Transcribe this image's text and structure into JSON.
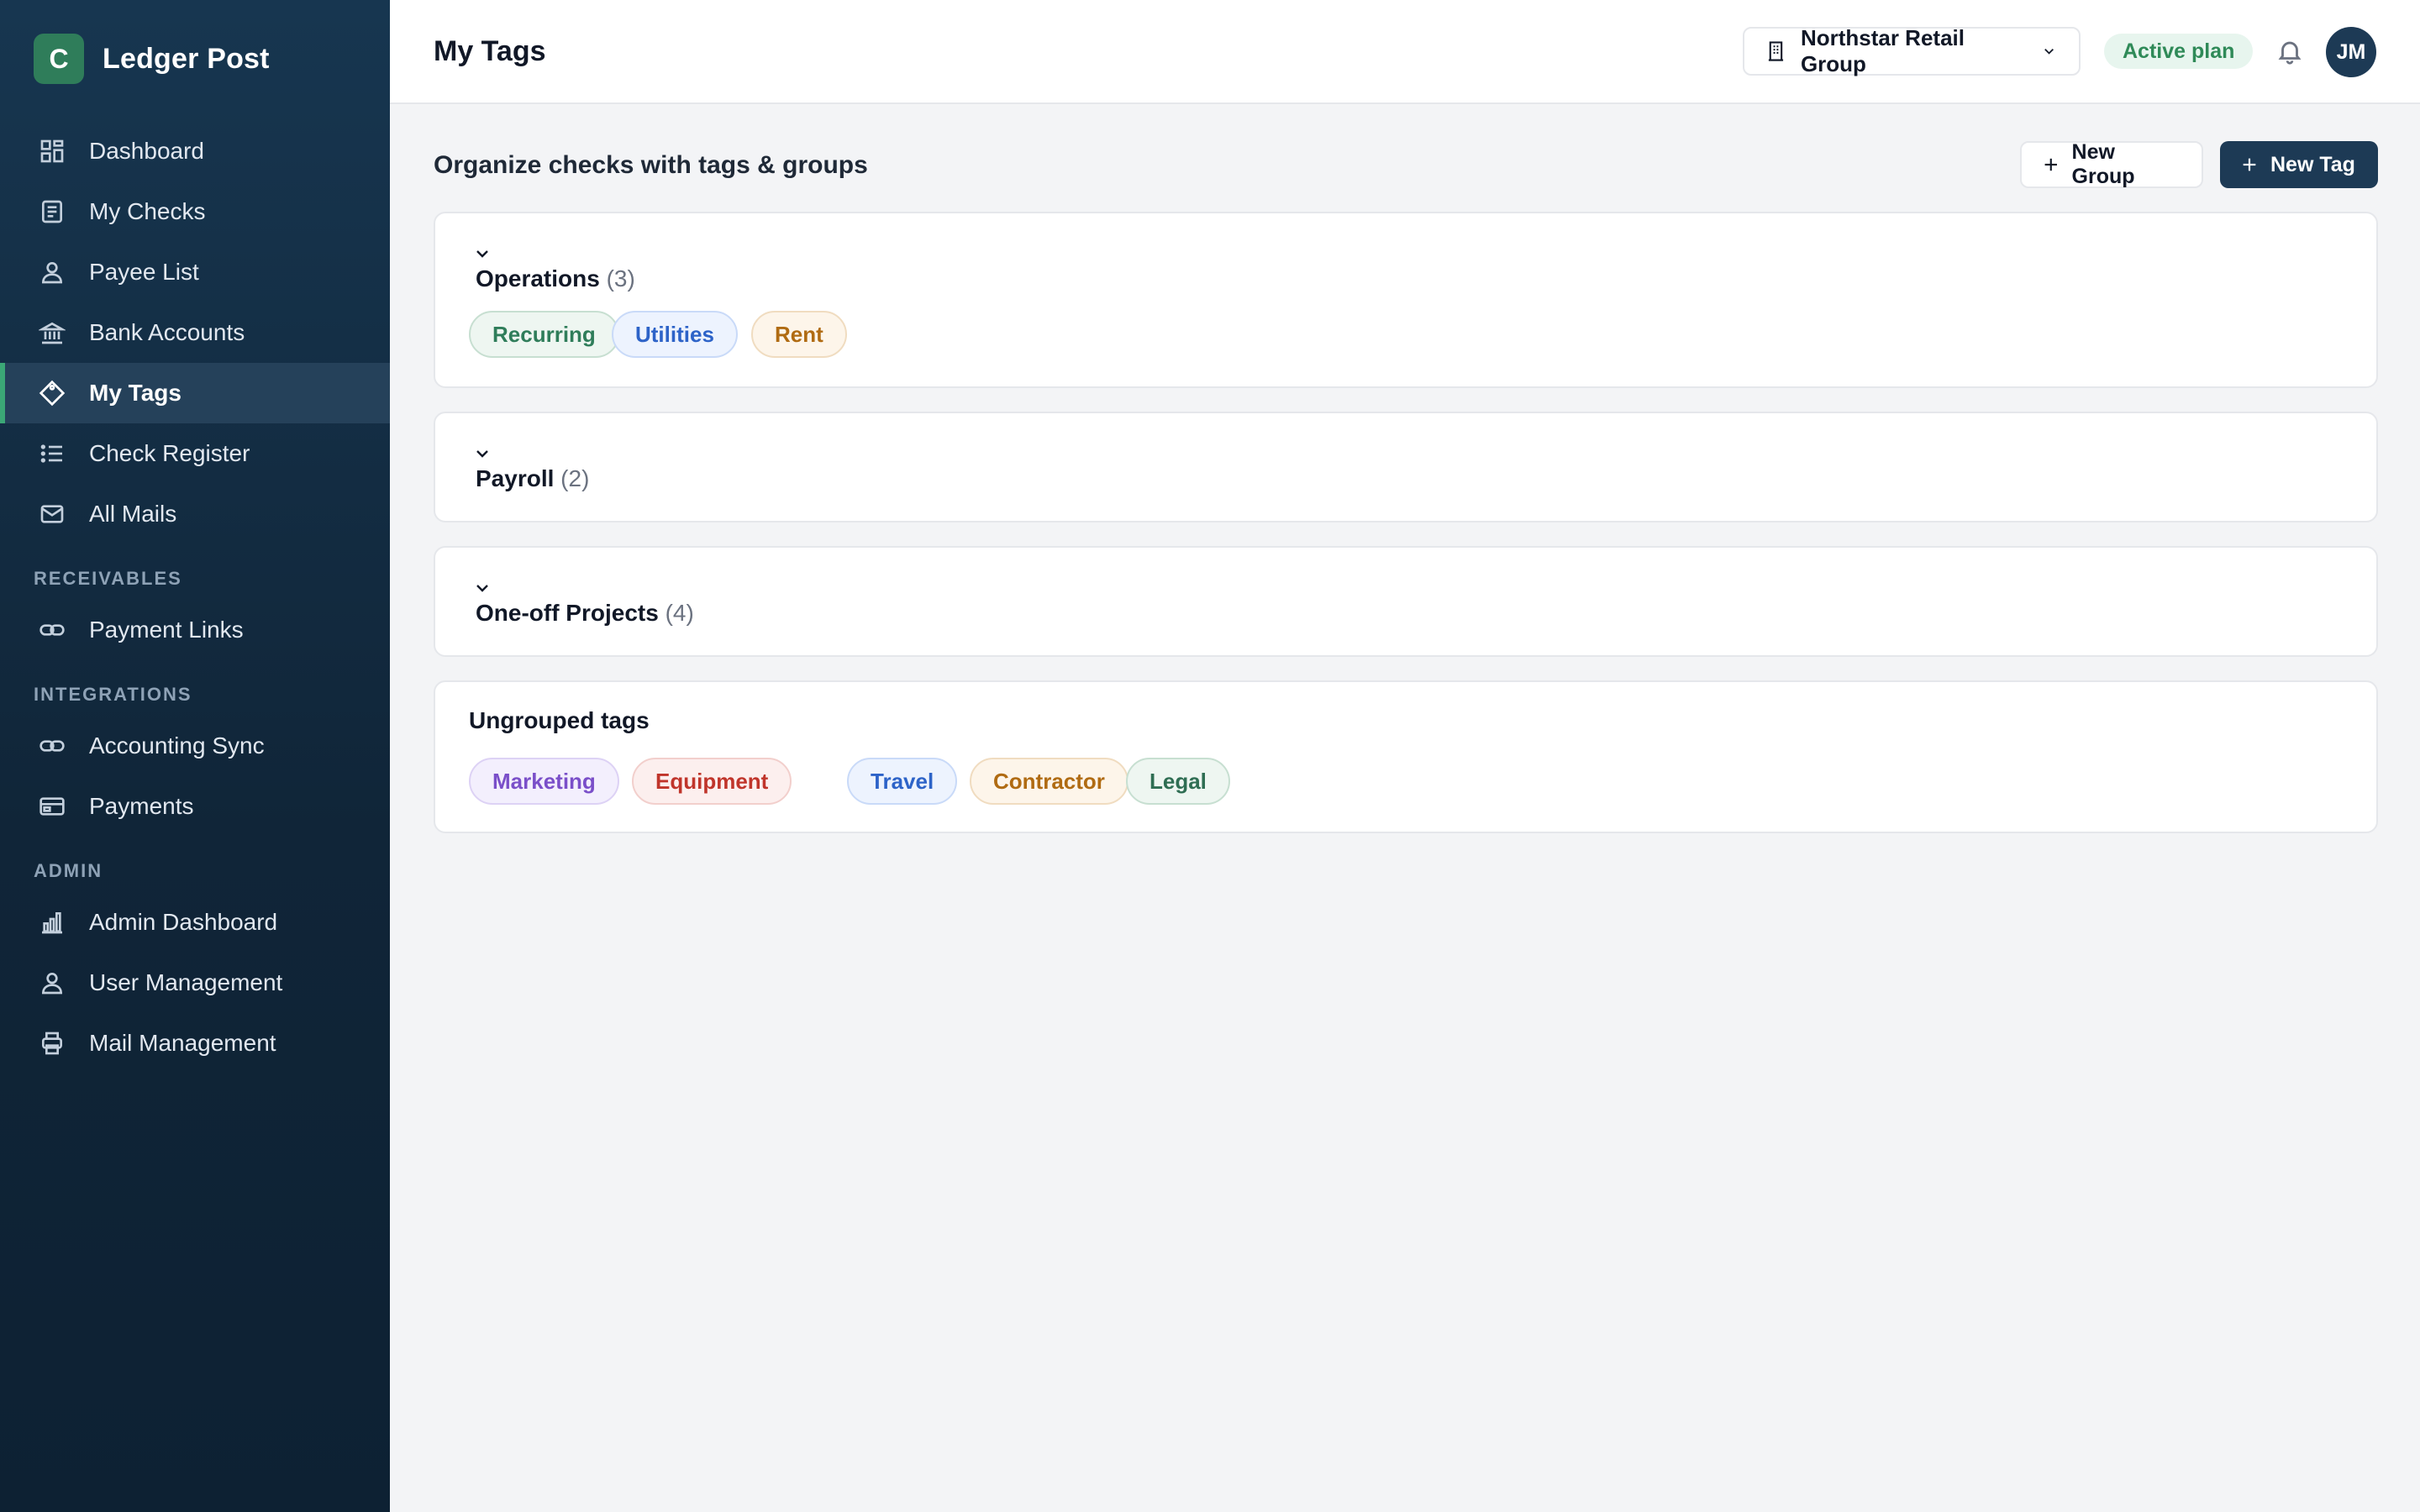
{
  "app": {
    "logo_letter": "C",
    "name": "Ledger Post"
  },
  "sidebar": {
    "items": [
      {
        "label": "Dashboard",
        "icon": "grid-icon"
      },
      {
        "label": "My Checks",
        "icon": "document-icon"
      },
      {
        "label": "Payee List",
        "icon": "person-icon"
      },
      {
        "label": "Bank Accounts",
        "icon": "bank-icon"
      },
      {
        "label": "My Tags",
        "icon": "tag-icon",
        "active": true
      },
      {
        "label": "Check Register",
        "icon": "list-icon"
      },
      {
        "label": "All Mails",
        "icon": "mail-icon"
      }
    ],
    "sections": [
      {
        "label": "RECEIVABLES",
        "items": [
          {
            "label": "Payment Links",
            "icon": "link-icon"
          }
        ]
      },
      {
        "label": "INTEGRATIONS",
        "items": [
          {
            "label": "Accounting Sync",
            "icon": "link-icon"
          },
          {
            "label": "Payments",
            "icon": "card-icon"
          }
        ]
      },
      {
        "label": "ADMIN",
        "items": [
          {
            "label": "Admin Dashboard",
            "icon": "bar-chart-icon"
          },
          {
            "label": "User Management",
            "icon": "person-icon"
          },
          {
            "label": "Mail Management",
            "icon": "printer-icon"
          }
        ]
      }
    ]
  },
  "header": {
    "title": "My Tags",
    "org": "Northstar Retail Group",
    "plan_badge": "Active plan",
    "avatar_initials": "JM"
  },
  "content": {
    "subtitle": "Organize checks with tags & groups",
    "new_group_label": "New Group",
    "new_tag_label": "New Tag",
    "groups": [
      {
        "name": "Operations",
        "count": "(3)",
        "tags": [
          "Recurring",
          "Utilities",
          "Rent"
        ]
      },
      {
        "name": "Payroll",
        "count": "(2)"
      },
      {
        "name": "One-off Projects",
        "count": "(4)"
      }
    ],
    "ungrouped": {
      "title": "Ungrouped tags",
      "tags": [
        "Marketing",
        "Equipment",
        "Travel",
        "Contractor",
        "Legal"
      ]
    }
  },
  "colors": {
    "sidebar_bg": "#102538",
    "accent_green": "#2f7d5a",
    "primary_button": "#1d3a55"
  }
}
